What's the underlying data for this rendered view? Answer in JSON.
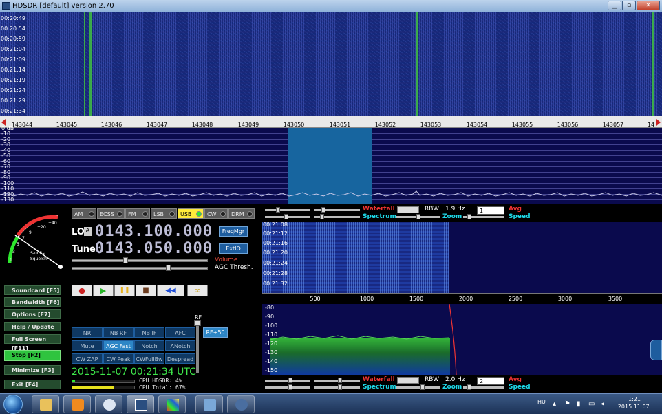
{
  "titlebar": {
    "title": "HDSDR [default]  version 2.70",
    "min": "▁",
    "max": "▫",
    "close": "✕"
  },
  "waterfall": {
    "times": [
      "00:20:49",
      "00:20:54",
      "00:20:59",
      "00:21:04",
      "00:21:09",
      "00:21:14",
      "00:21:19",
      "00:21:24",
      "00:21:29",
      "00:21:34"
    ]
  },
  "freq_scale": {
    "labels": [
      "143044",
      "143045",
      "143046",
      "143047",
      "143048",
      "143049",
      "143050",
      "143051",
      "143052",
      "143053",
      "143054",
      "143055",
      "143056",
      "143057",
      "14"
    ]
  },
  "spectrum": {
    "labels": [
      "0 dB",
      "-10",
      "-20",
      "-30",
      "-40",
      "-50",
      "-60",
      "-70",
      "-80",
      "-90",
      "-100",
      "-110",
      "-120",
      "-130"
    ]
  },
  "smeter": {
    "scale": [
      "1",
      "3",
      "5",
      "7",
      "9",
      "+20",
      "+40"
    ],
    "label_units": "S-units",
    "label_squelch": "Squelch"
  },
  "modes": [
    {
      "label": "AM",
      "active": false
    },
    {
      "label": "ECSS",
      "active": false
    },
    {
      "label": "FM",
      "active": false
    },
    {
      "label": "LSB",
      "active": false
    },
    {
      "label": "USB",
      "active": true
    },
    {
      "label": "CW",
      "active": false
    },
    {
      "label": "DRM",
      "active": false
    }
  ],
  "lo": {
    "label": "LO",
    "box": "A",
    "value": "0143.100.000"
  },
  "tune": {
    "label": "Tune",
    "value": "0143.050.000"
  },
  "buttons": {
    "freqmgr": "FreqMgr",
    "extio": "ExtIO",
    "rf50": "RF+50"
  },
  "labels": {
    "volume": "Volume",
    "agc_thresh": "AGC Thresh.",
    "rf": "RF"
  },
  "left_buttons": [
    {
      "label": "Soundcard  [F5]"
    },
    {
      "label": "Bandwidth  [F6]"
    },
    {
      "label": "Options     [F7]"
    },
    {
      "label": "Help / Update  [F1]"
    },
    {
      "label": "Full Screen  [F11]"
    },
    {
      "label": "Stop         [F2]"
    },
    {
      "label": "Minimize  [F3]"
    },
    {
      "label": "Exit         [F4]"
    }
  ],
  "transport": {
    "record": "●",
    "play": "▶",
    "pause": "❚❚",
    "stop": "■",
    "rewind": "◀◀",
    "loop": "∞"
  },
  "dsp": [
    {
      "label": "NR",
      "on": false
    },
    {
      "label": "NB RF",
      "on": false
    },
    {
      "label": "NB IF",
      "on": false
    },
    {
      "label": "AFC",
      "on": false
    },
    {
      "label": "Mute",
      "on": false
    },
    {
      "label": "AGC Fast",
      "on": true
    },
    {
      "label": "Notch",
      "on": false
    },
    {
      "label": "ANotch",
      "on": false
    },
    {
      "label": "CW ZAP",
      "on": false
    },
    {
      "label": "CW Peak",
      "on": false
    },
    {
      "label": "CWFullBw",
      "on": false
    },
    {
      "label": "Despread",
      "on": false
    }
  ],
  "status": {
    "datetime": "2015-11-07  00:21:34 UTC",
    "cpu_hdsdr": "CPU HDSDR:  4%",
    "cpu_total": "CPU Total:  67%",
    "cpu_hdsdr_pct": 4,
    "cpu_total_pct": 67
  },
  "af_top": {
    "waterfall": "Waterfall",
    "spectrum": "Spectrum",
    "rbw_label": "RBW",
    "rbw": "1.9 Hz",
    "avg_value": "1",
    "avg": "Avg",
    "zoom": "Zoom",
    "speed": "Speed"
  },
  "af_bottom": {
    "waterfall": "Waterfall",
    "spectrum": "Spectrum",
    "rbw_label": "RBW",
    "rbw": "2.0 Hz",
    "avg_value": "2",
    "avg": "Avg",
    "zoom": "Zoom",
    "speed": "Speed"
  },
  "af_waterfall": {
    "times": [
      "00:21:08",
      "00:21:12",
      "00:21:16",
      "00:21:20",
      "00:21:24",
      "00:21:28",
      "00:21:32"
    ]
  },
  "af_freq": {
    "labels": [
      "500",
      "1000",
      "1500",
      "2000",
      "2500",
      "3000",
      "3500"
    ]
  },
  "af_spectrum": {
    "labels": [
      "-80",
      "-90",
      "-100",
      "-110",
      "-120",
      "-130",
      "-140",
      "-150"
    ]
  },
  "taskbar": {
    "lang": "HU",
    "time": "1:21",
    "date": "2015.11.07."
  },
  "colors": {
    "waterfall_bg": "#14287a",
    "spectrum_bg": "#0a0a4d",
    "filter": "#17659f",
    "active_mode": "#ffeb3b",
    "stop": "#2fc43f",
    "accent_red": "#e33",
    "accent_cyan": "#1ed9e8"
  }
}
